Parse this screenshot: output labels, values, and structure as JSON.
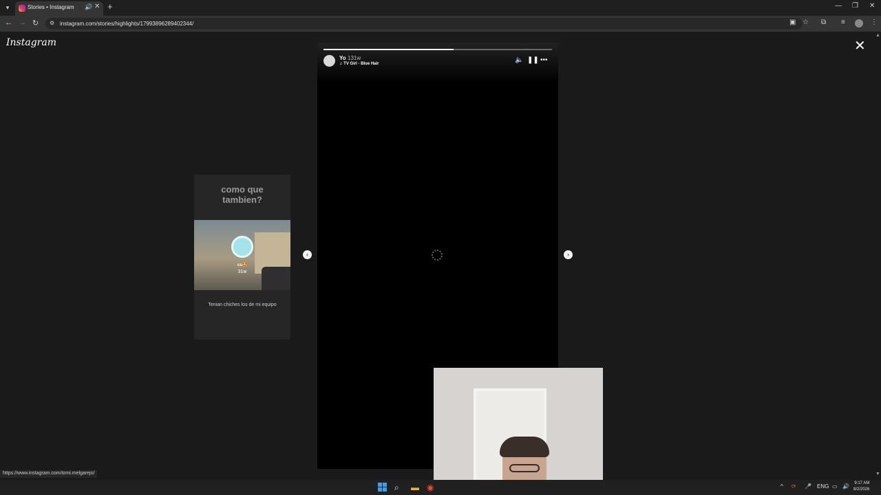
{
  "browser": {
    "tab": {
      "title": "Stories • Instagram"
    },
    "address_bar": {
      "url": "instagram.com/stories/highlights/17993896289402344/"
    },
    "status_url": "https://www.instagram.com/tomi.melgarejo/"
  },
  "page": {
    "logo": "Instagram",
    "close_label": "✕"
  },
  "prev_story": {
    "heading_line1": "como que",
    "heading_line2": "tambien?",
    "username": "cs🤩",
    "age": "31w",
    "caption": "Tenian chiches los de mi equipo"
  },
  "story": {
    "username": "Yo",
    "age": "131w",
    "audio": "TV Girl · Blue Hair",
    "progress": {
      "segments": 2,
      "current_segment_fraction": 0.57
    }
  },
  "taskbar": {
    "language": "ENG",
    "time": "9:17 AM",
    "date": "8/2/2026"
  },
  "colors": {
    "accent_gradient": [
      "#f9b233",
      "#e1306c",
      "#833ab4"
    ],
    "background": "#1a1a1a",
    "progress_played": "#ffffff",
    "progress_remaining": "#6a6a6a"
  }
}
